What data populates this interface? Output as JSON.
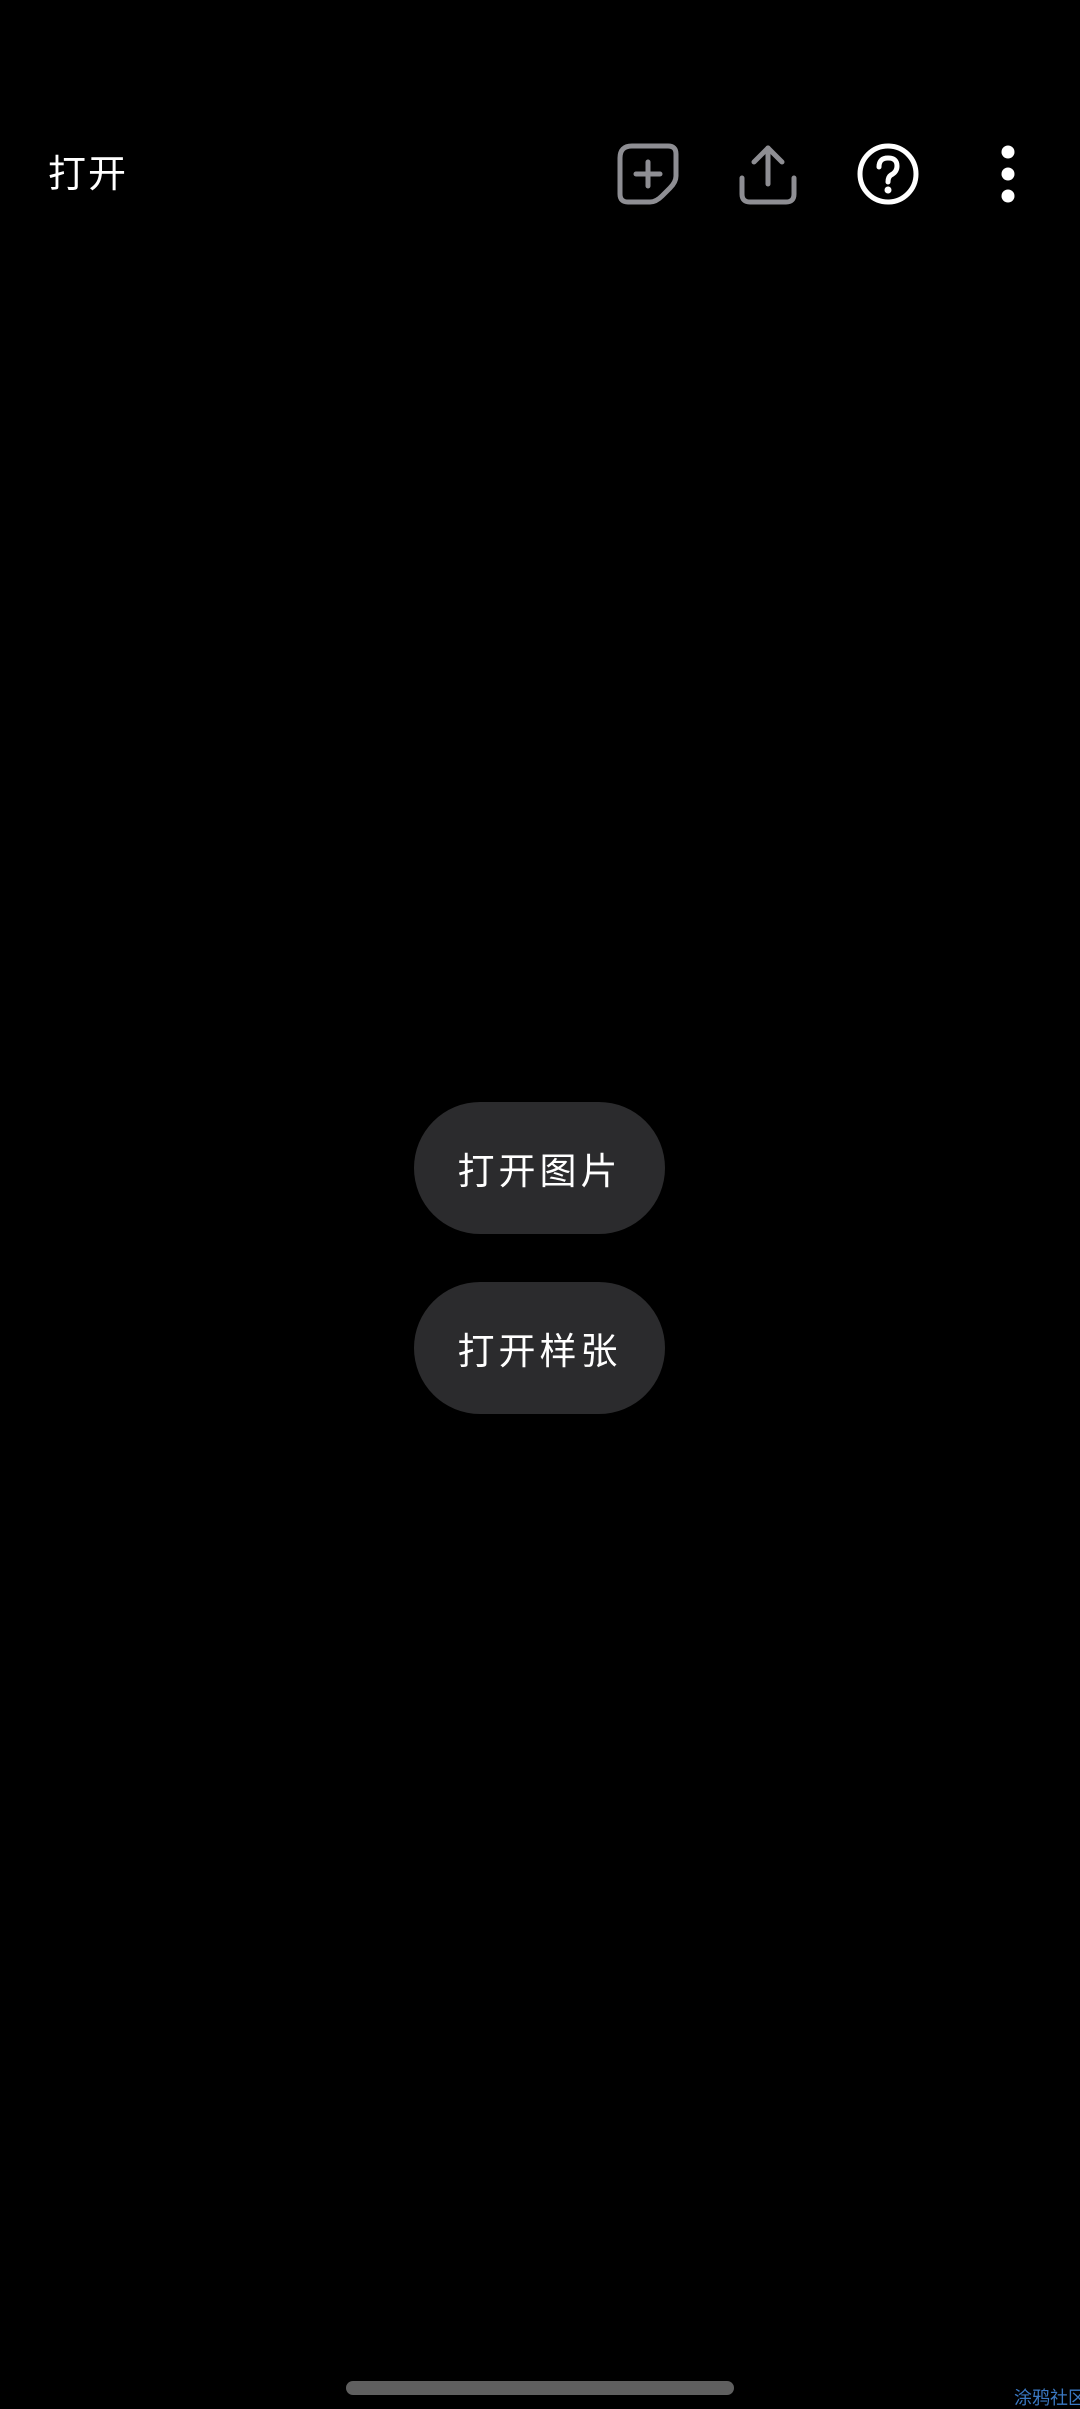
{
  "app_bar": {
    "title": "打开",
    "icons": [
      {
        "name": "new-sticker-icon",
        "color": "#8e8e93"
      },
      {
        "name": "share-icon",
        "color": "#8e8e93"
      },
      {
        "name": "help-icon",
        "color": "#ffffff"
      },
      {
        "name": "more-vert-icon",
        "color": "#ffffff"
      }
    ]
  },
  "main": {
    "open_image_label": "打开图片",
    "open_sample_label": "打开样张"
  },
  "watermark": "涂鸦社区",
  "colors": {
    "background": "#000000",
    "pill_background": "#2b2b2d",
    "text": "#ffffff",
    "disabled_icon": "#8e8e93",
    "home_indicator": "#5f5f5f",
    "watermark": "#3a78c2"
  }
}
